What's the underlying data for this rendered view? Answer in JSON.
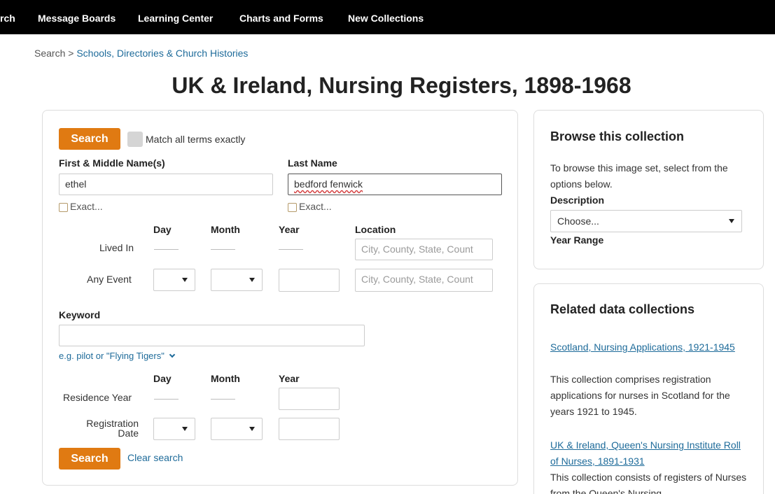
{
  "topnav": {
    "items": [
      "rch",
      "Message Boards",
      "Learning Center",
      "Charts and Forms",
      "New Collections"
    ]
  },
  "breadcrumb": {
    "root": "Search",
    "separator": ">",
    "current": "Schools, Directories & Church Histories"
  },
  "page_title": "UK & Ireland, Nursing Registers, 1898-1968",
  "search_form": {
    "search_button": "Search",
    "match_exact_label": "Match all terms exactly",
    "first_name": {
      "label": "First & Middle Name(s)",
      "value": "ethel",
      "exact_label": "Exact..."
    },
    "last_name": {
      "label": "Last Name",
      "value": "bedford fenwick",
      "exact_label": "Exact..."
    },
    "headers": {
      "day": "Day",
      "month": "Month",
      "year": "Year",
      "location": "Location"
    },
    "lived_in": {
      "label": "Lived In",
      "location_placeholder": "City, County, State, Count"
    },
    "any_event": {
      "label": "Any Event",
      "location_placeholder": "City, County, State, Count"
    },
    "keyword": {
      "label": "Keyword",
      "value": "",
      "hint": "e.g. pilot or \"Flying Tigers\""
    },
    "headers2": {
      "day": "Day",
      "month": "Month",
      "year": "Year"
    },
    "residence_year": {
      "label": "Residence Year"
    },
    "registration_date": {
      "label_line1": "Registration",
      "label_line2": "Date"
    },
    "bottom_search_button": "Search",
    "clear_link": "Clear search"
  },
  "browse": {
    "heading": "Browse this collection",
    "intro": "To browse this image set, select from the options below.",
    "description_label": "Description",
    "description_value": "Choose...",
    "year_range_label": "Year Range"
  },
  "related": {
    "heading": "Related data collections",
    "items": [
      {
        "title": "Scotland, Nursing Applications, 1921-1945",
        "description": "This collection comprises registration applications for nurses in Scotland for the years 1921 to 1945."
      },
      {
        "title": "UK & Ireland, Queen's Nursing Institute Roll of Nurses, 1891-1931",
        "description": "This collection consists of registers of Nurses from the Queen's Nursing"
      }
    ]
  },
  "colors": {
    "nav_bg": "#000000",
    "accent_orange": "#e07a12",
    "link_blue": "#1e6b9a"
  }
}
